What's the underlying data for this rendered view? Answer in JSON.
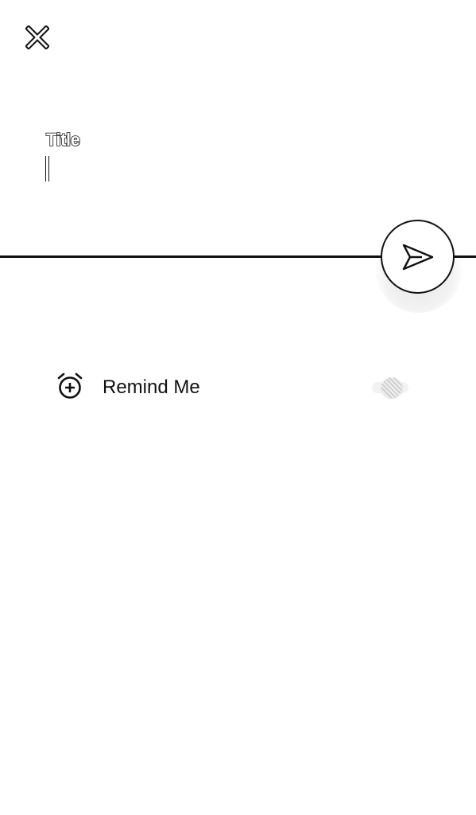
{
  "header": {
    "close_icon": "close-icon"
  },
  "title_field": {
    "label": "Title",
    "value": ""
  },
  "send_button": {
    "icon": "send-icon"
  },
  "reminder": {
    "icon": "alarm-add-icon",
    "label": "Remind Me",
    "enabled": false
  },
  "colors": {
    "foreground": "#111111",
    "background": "#ffffff"
  }
}
